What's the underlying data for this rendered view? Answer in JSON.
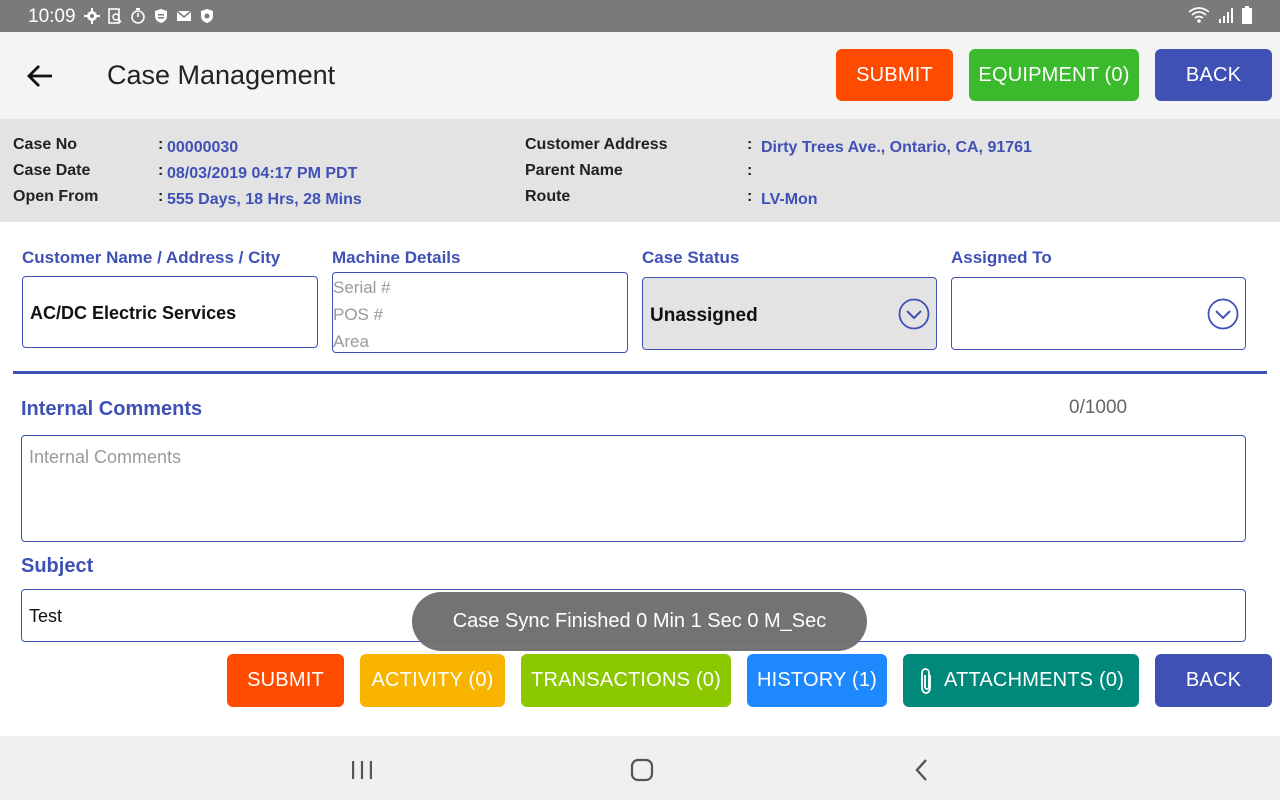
{
  "status_bar": {
    "time": "10:09",
    "left_icons": [
      "settings-icon",
      "search-doc-icon",
      "timer-icon",
      "shield-badge-icon",
      "mail-icon",
      "shield-icon"
    ],
    "right_icons": [
      "wifi-icon",
      "signal-icon",
      "battery-icon"
    ]
  },
  "header": {
    "title": "Case Management",
    "submit_label": "SUBMIT",
    "equipment_label": "EQUIPMENT (0)",
    "back_label": "BACK"
  },
  "info": {
    "case_no_label": "Case No",
    "case_no": "00000030",
    "case_date_label": "Case Date",
    "case_date": "08/03/2019 04:17 PM PDT",
    "open_from_label": "Open From",
    "open_from": "555 Days, 18 Hrs, 28 Mins",
    "customer_address_label": "Customer Address",
    "customer_address": "Dirty Trees Ave., Ontario, CA, 91761",
    "parent_name_label": "Parent Name",
    "parent_name": "",
    "route_label": "Route",
    "route": "LV-Mon",
    "colon": ":"
  },
  "form": {
    "customer_label": "Customer Name / Address / City",
    "customer_value": "AC/DC Electric Services",
    "machine_label": "Machine Details",
    "machine_placeholders": [
      "Serial #",
      "POS #",
      "Area"
    ],
    "case_status_label": "Case Status",
    "case_status_value": "Unassigned",
    "assigned_to_label": "Assigned To",
    "assigned_to_value": "",
    "internal_comments_label": "Internal Comments",
    "internal_comments_counter": "0/1000",
    "internal_comments_placeholder": "Internal Comments",
    "subject_label": "Subject",
    "subject_value": "Test"
  },
  "toast": {
    "message": "Case Sync Finished  0 Min 1 Sec 0 M_Sec"
  },
  "footer": {
    "submit_label": "SUBMIT",
    "activity_label": "ACTIVITY (0)",
    "transactions_label": "TRANSACTIONS (0)",
    "history_label": "HISTORY (1)",
    "attachments_label": "ATTACHMENTS (0)",
    "back_label": "BACK"
  },
  "colors": {
    "accent": "#3f51b5",
    "submit": "#ff4b00",
    "equipment": "#3cba2e",
    "activity": "#f9b400",
    "transactions": "#8bc800",
    "history": "#1e88ff",
    "attachments": "#00897b"
  },
  "nav_bar": {
    "icons": [
      "recents-icon",
      "home-icon",
      "back-nav-icon"
    ]
  }
}
